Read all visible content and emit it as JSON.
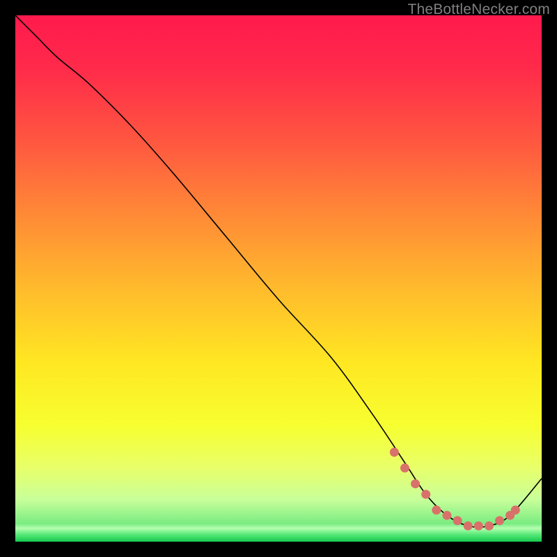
{
  "watermark": "TheBottleNecker.com",
  "chart_data": {
    "type": "line",
    "title": "",
    "xlabel": "",
    "ylabel": "",
    "xlim": [
      0,
      100
    ],
    "ylim": [
      0,
      100
    ],
    "series": [
      {
        "name": "bottleneck-curve",
        "x": [
          0,
          4,
          8,
          14,
          22,
          30,
          40,
          50,
          60,
          68,
          74,
          78,
          82,
          86,
          90,
          94,
          100
        ],
        "y": [
          100,
          96,
          92,
          87,
          79,
          70,
          58,
          46,
          35,
          24,
          15,
          9,
          5,
          3,
          3,
          5,
          12
        ]
      }
    ],
    "markers": {
      "name": "highlighted-range",
      "x": [
        72,
        74,
        76,
        78,
        80,
        82,
        84,
        86,
        88,
        90,
        92,
        94,
        95
      ],
      "y": [
        17,
        14,
        11,
        9,
        6,
        5,
        4,
        3,
        3,
        3,
        4,
        5,
        6
      ]
    }
  }
}
